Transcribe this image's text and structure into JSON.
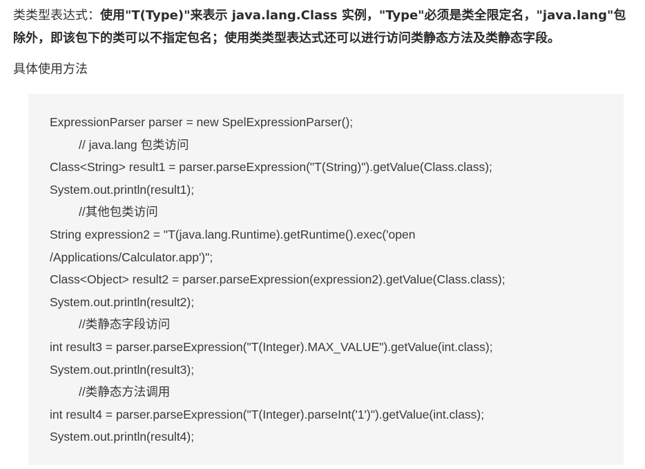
{
  "intro": {
    "label": "类类型表达式：",
    "body": "使用\"T(Type)\"来表示 java.lang.Class 实例，\"Type\"必须是类全限定名，\"java.lang\"包除外，即该包下的类可以不指定包名；使用类类型表达式还可以进行访问类静态方法及类静态字段。"
  },
  "usage_title": "具体使用方法",
  "code": [
    {
      "text": "ExpressionParser parser = new SpelExpressionParser();",
      "indent": false
    },
    {
      "text": "// java.lang 包类访问",
      "indent": true
    },
    {
      "text": "Class<String> result1 = parser.parseExpression(\"T(String)\").getValue(Class.class);",
      "indent": false
    },
    {
      "text": "System.out.println(result1);",
      "indent": false
    },
    {
      "text": "//其他包类访问",
      "indent": true
    },
    {
      "text": "String expression2 = \"T(java.lang.Runtime).getRuntime().exec('open",
      "indent": false
    },
    {
      "text": "/Applications/Calculator.app')\";",
      "indent": false
    },
    {
      "text": "Class<Object> result2 = parser.parseExpression(expression2).getValue(Class.class);",
      "indent": false
    },
    {
      "text": "System.out.println(result2);",
      "indent": false
    },
    {
      "text": "//类静态字段访问",
      "indent": true
    },
    {
      "text": "int result3 = parser.parseExpression(\"T(Integer).MAX_VALUE\").getValue(int.class);",
      "indent": false
    },
    {
      "text": "System.out.println(result3);",
      "indent": false
    },
    {
      "text": "//类静态方法调用",
      "indent": true
    },
    {
      "text": "int result4 = parser.parseExpression(\"T(Integer).parseInt('1')\").getValue(int.class);",
      "indent": false
    },
    {
      "text": "System.out.println(result4);",
      "indent": false
    }
  ]
}
